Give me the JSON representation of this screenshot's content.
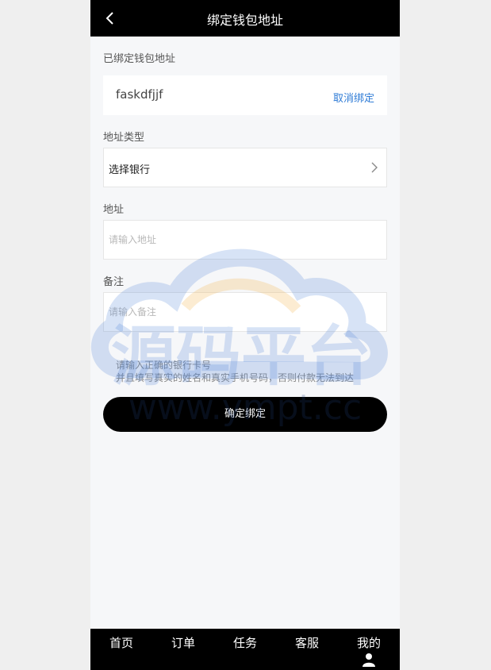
{
  "header": {
    "title": "绑定钱包地址"
  },
  "bound": {
    "label": "已绑定钱包地址",
    "value": "faskdfjjf",
    "unbind_label": "取消绑定"
  },
  "address_type": {
    "label": "地址类型",
    "value": "选择银行"
  },
  "address": {
    "label": "地址",
    "placeholder": "请输入地址"
  },
  "remark": {
    "label": "备注",
    "placeholder": "请输入备注"
  },
  "tips": {
    "line1": "请输入正确的银行卡号",
    "line2": "并且填写真实的姓名和真实手机号码，否则付款无法到达"
  },
  "confirm_label": "确定绑定",
  "watermark": {
    "text": "源码平台",
    "url": "www.ympt.cc"
  },
  "tabs": [
    {
      "label": "首页"
    },
    {
      "label": "订单"
    },
    {
      "label": "任务"
    },
    {
      "label": "客服"
    },
    {
      "label": "我的"
    }
  ],
  "colors": {
    "accent": "#2e7bd6",
    "header_bg": "#000000",
    "page_bg": "#f6f7f9"
  }
}
